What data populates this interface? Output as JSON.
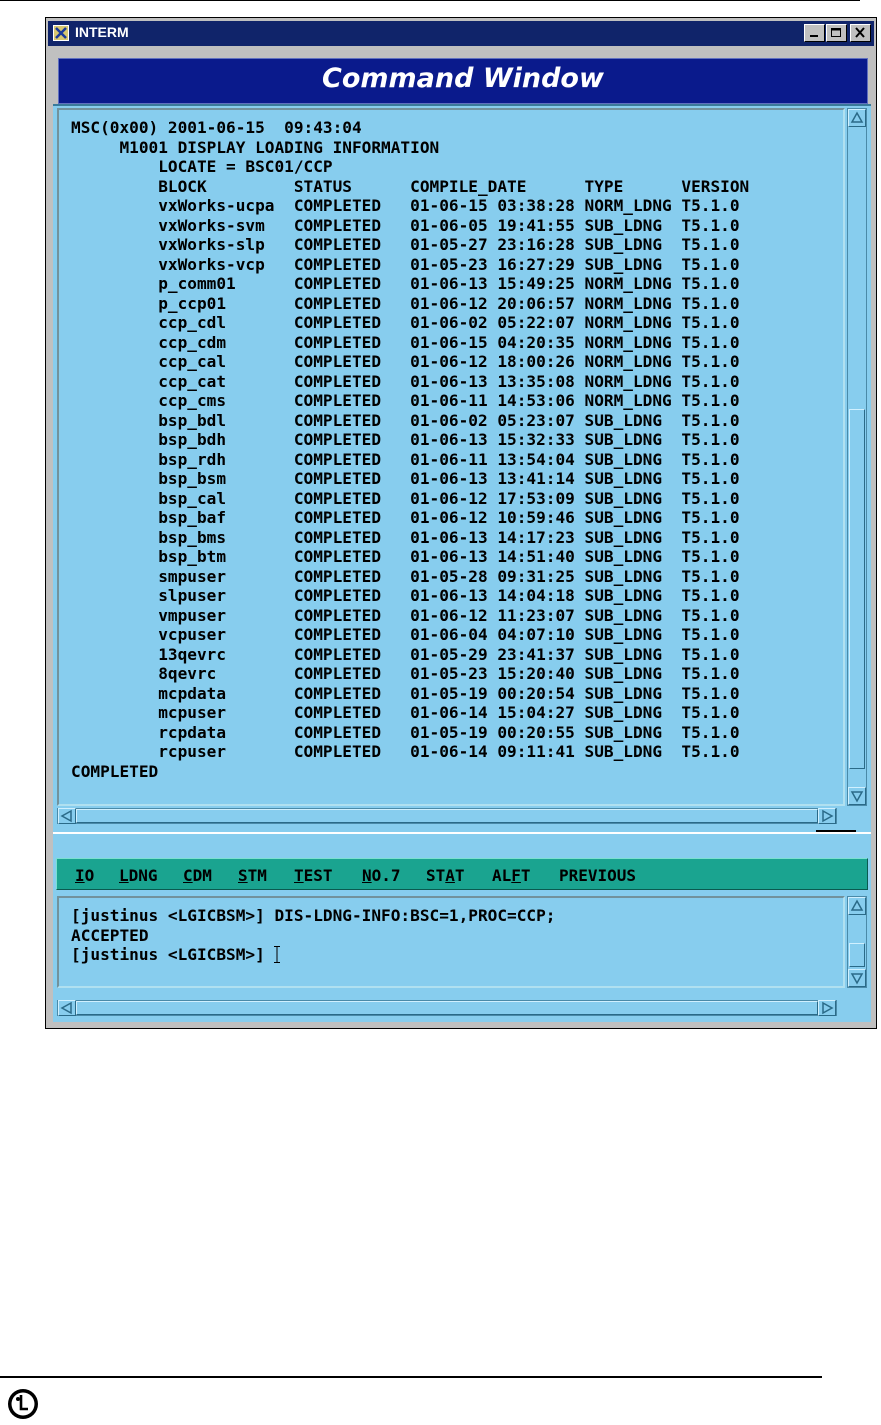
{
  "window": {
    "title": "INTERM",
    "header_title": "Command Window"
  },
  "output": {
    "header_line": "MSC(0x00) 2001-06-15  09:43:04",
    "command_line": "     M1001 DISPLAY LOADING INFORMATION",
    "locate_line": "         LOCATE = BSC01/CCP",
    "columns": [
      "BLOCK",
      "STATUS",
      "COMPILE_DATE",
      "TYPE",
      "VERSION"
    ],
    "rows": [
      [
        "vxWorks-ucpa",
        "COMPLETED",
        "01-06-15 03:38:28",
        "NORM_LDNG",
        "T5.1.0"
      ],
      [
        "vxWorks-svm",
        "COMPLETED",
        "01-06-05 19:41:55",
        "SUB_LDNG",
        "T5.1.0"
      ],
      [
        "vxWorks-slp",
        "COMPLETED",
        "01-05-27 23:16:28",
        "SUB_LDNG",
        "T5.1.0"
      ],
      [
        "vxWorks-vcp",
        "COMPLETED",
        "01-05-23 16:27:29",
        "SUB_LDNG",
        "T5.1.0"
      ],
      [
        "p_comm01",
        "COMPLETED",
        "01-06-13 15:49:25",
        "NORM_LDNG",
        "T5.1.0"
      ],
      [
        "p_ccp01",
        "COMPLETED",
        "01-06-12 20:06:57",
        "NORM_LDNG",
        "T5.1.0"
      ],
      [
        "ccp_cdl",
        "COMPLETED",
        "01-06-02 05:22:07",
        "NORM_LDNG",
        "T5.1.0"
      ],
      [
        "ccp_cdm",
        "COMPLETED",
        "01-06-15 04:20:35",
        "NORM_LDNG",
        "T5.1.0"
      ],
      [
        "ccp_cal",
        "COMPLETED",
        "01-06-12 18:00:26",
        "NORM_LDNG",
        "T5.1.0"
      ],
      [
        "ccp_cat",
        "COMPLETED",
        "01-06-13 13:35:08",
        "NORM_LDNG",
        "T5.1.0"
      ],
      [
        "ccp_cms",
        "COMPLETED",
        "01-06-11 14:53:06",
        "NORM_LDNG",
        "T5.1.0"
      ],
      [
        "bsp_bdl",
        "COMPLETED",
        "01-06-02 05:23:07",
        "SUB_LDNG",
        "T5.1.0"
      ],
      [
        "bsp_bdh",
        "COMPLETED",
        "01-06-13 15:32:33",
        "SUB_LDNG",
        "T5.1.0"
      ],
      [
        "bsp_rdh",
        "COMPLETED",
        "01-06-11 13:54:04",
        "SUB_LDNG",
        "T5.1.0"
      ],
      [
        "bsp_bsm",
        "COMPLETED",
        "01-06-13 13:41:14",
        "SUB_LDNG",
        "T5.1.0"
      ],
      [
        "bsp_cal",
        "COMPLETED",
        "01-06-12 17:53:09",
        "SUB_LDNG",
        "T5.1.0"
      ],
      [
        "bsp_baf",
        "COMPLETED",
        "01-06-12 10:59:46",
        "SUB_LDNG",
        "T5.1.0"
      ],
      [
        "bsp_bms",
        "COMPLETED",
        "01-06-13 14:17:23",
        "SUB_LDNG",
        "T5.1.0"
      ],
      [
        "bsp_btm",
        "COMPLETED",
        "01-06-13 14:51:40",
        "SUB_LDNG",
        "T5.1.0"
      ],
      [
        "smpuser",
        "COMPLETED",
        "01-05-28 09:31:25",
        "SUB_LDNG",
        "T5.1.0"
      ],
      [
        "slpuser",
        "COMPLETED",
        "01-06-13 14:04:18",
        "SUB_LDNG",
        "T5.1.0"
      ],
      [
        "vmpuser",
        "COMPLETED",
        "01-06-12 11:23:07",
        "SUB_LDNG",
        "T5.1.0"
      ],
      [
        "vcpuser",
        "COMPLETED",
        "01-06-04 04:07:10",
        "SUB_LDNG",
        "T5.1.0"
      ],
      [
        "13qevrc",
        "COMPLETED",
        "01-05-29 23:41:37",
        "SUB_LDNG",
        "T5.1.0"
      ],
      [
        "8qevrc",
        "COMPLETED",
        "01-05-23 15:20:40",
        "SUB_LDNG",
        "T5.1.0"
      ],
      [
        "mcpdata",
        "COMPLETED",
        "01-05-19 00:20:54",
        "SUB_LDNG",
        "T5.1.0"
      ],
      [
        "mcpuser",
        "COMPLETED",
        "01-06-14 15:04:27",
        "SUB_LDNG",
        "T5.1.0"
      ],
      [
        "rcpdata",
        "COMPLETED",
        "01-05-19 00:20:55",
        "SUB_LDNG",
        "T5.1.0"
      ],
      [
        "rcpuser",
        "COMPLETED",
        "01-06-14 09:11:41",
        "SUB_LDNG",
        "T5.1.0"
      ]
    ],
    "footer_line": "COMPLETED"
  },
  "menu": [
    {
      "label": "IO",
      "hotkey_index": 0
    },
    {
      "label": "LDNG",
      "hotkey_index": 0
    },
    {
      "label": "CDM",
      "hotkey_index": 0
    },
    {
      "label": "STM",
      "hotkey_index": 0
    },
    {
      "label": "TEST",
      "hotkey_index": 0
    },
    {
      "label": "NO.7",
      "hotkey_index": 0
    },
    {
      "label": "STAT",
      "hotkey_index": 2
    },
    {
      "label": "ALFT",
      "hotkey_index": 2
    },
    {
      "label": "PREVIOUS",
      "hotkey_index": -1
    }
  ],
  "console": {
    "lines": [
      "[justinus <LGICBSM>] DIS-LDNG-INFO:BSC=1,PROC=CCP;",
      "ACCEPTED",
      "[justinus <LGICBSM>] "
    ]
  },
  "colors": {
    "panel": "#87cdee",
    "titlebar": "#10246a",
    "header": "#0a1a8c",
    "menubar": "#1aa490"
  },
  "icons": [
    "app-icon",
    "minimize-icon",
    "maximize-icon",
    "close-icon",
    "scroll-up-icon",
    "scroll-down-icon",
    "scroll-left-icon",
    "scroll-right-icon",
    "lg-logo-icon"
  ]
}
